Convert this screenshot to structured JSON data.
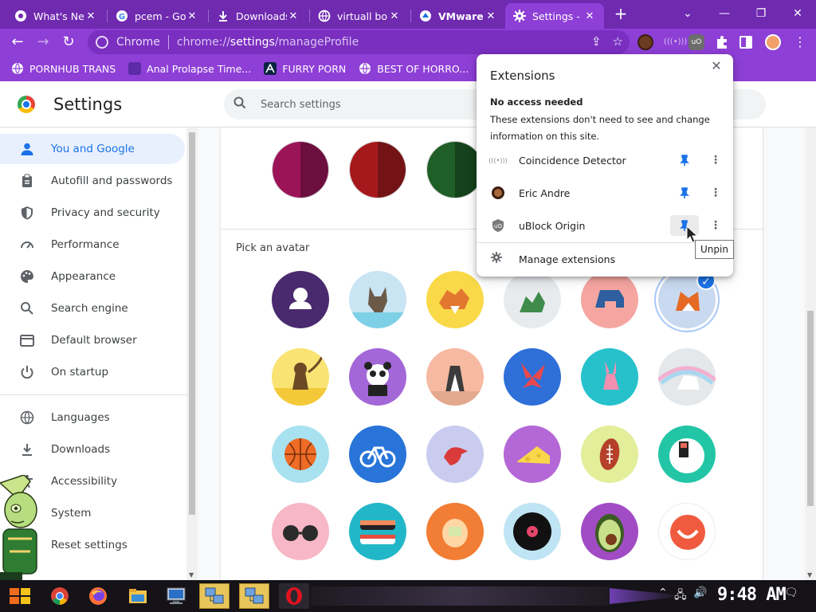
{
  "tabs": [
    {
      "title": "What's Ne",
      "icon": "chrome-pink-icon",
      "active": false
    },
    {
      "title": "pcem - Go",
      "icon": "google-icon",
      "active": false
    },
    {
      "title": "Downloads",
      "icon": "download-icon",
      "active": false
    },
    {
      "title": "virtuall bo",
      "icon": "globe-icon",
      "active": false
    },
    {
      "title": "VMware Pl",
      "icon": "vmware-icon",
      "active": false
    },
    {
      "title": "Settings -",
      "icon": "gear-icon",
      "active": true
    }
  ],
  "window_controls": {
    "minimize": "—",
    "restore": "❐",
    "close": "✕",
    "tab_search": "⌄"
  },
  "toolbar": {
    "site_label": "Chrome",
    "url_scheme": "chrome://",
    "url_host": "settings",
    "url_path": "/manageProfile"
  },
  "bookmarks": [
    {
      "label": "PORNHUB TRANS",
      "icon": "globe-icon"
    },
    {
      "label": "Anal Prolapse Time...",
      "icon": "purple-square-icon"
    },
    {
      "label": "FURRY PORN",
      "icon": "a-logo-icon"
    },
    {
      "label": "BEST OF HORRO...",
      "icon": "globe-icon"
    }
  ],
  "settings": {
    "title": "Settings",
    "search_placeholder": "Search settings",
    "nav": [
      {
        "label": "You and Google",
        "icon": "person-icon",
        "active": true
      },
      {
        "label": "Autofill and passwords",
        "icon": "clipboard-icon",
        "active": false
      },
      {
        "label": "Privacy and security",
        "icon": "shield-icon",
        "active": false
      },
      {
        "label": "Performance",
        "icon": "speedometer-icon",
        "active": false
      },
      {
        "label": "Appearance",
        "icon": "palette-icon",
        "active": false
      },
      {
        "label": "Search engine",
        "icon": "search-icon",
        "active": false
      },
      {
        "label": "Default browser",
        "icon": "browser-icon",
        "active": false
      },
      {
        "label": "On startup",
        "icon": "power-icon",
        "active": false
      },
      {
        "label": "Languages",
        "icon": "globe-icon",
        "active": false
      },
      {
        "label": "Downloads",
        "icon": "download-icon",
        "active": false
      },
      {
        "label": "Accessibility",
        "icon": "accessibility-icon",
        "active": false
      },
      {
        "label": "System",
        "icon": "wrench-icon",
        "active": false
      },
      {
        "label": "Reset settings",
        "icon": "reset-icon",
        "active": false
      }
    ],
    "pick_avatar_label": "Pick an avatar",
    "color_swatches": [
      {
        "left": "#9c1458",
        "right": "#6d0f3e"
      },
      {
        "left": "#a5191c",
        "right": "#741315"
      },
      {
        "left": "#1f5e26",
        "right": "#14421a"
      }
    ],
    "avatars": [
      {
        "name": "generic-person",
        "bg": "#4a2a6e",
        "fg": "#ffffff"
      },
      {
        "name": "origami-cat",
        "bg": "#c9e4f2",
        "fg": "#6b5a48"
      },
      {
        "name": "origami-corgi",
        "bg": "#f9d948",
        "fg": "#e2772f"
      },
      {
        "name": "origami-dragon",
        "bg": "#e7ebee",
        "fg": "#3f8b4b"
      },
      {
        "name": "origami-elephant",
        "bg": "#f6a6a1",
        "fg": "#2e5f9e"
      },
      {
        "name": "origami-fox",
        "bg": "#c9d9f0",
        "fg": "#e66a25",
        "selected": true
      },
      {
        "name": "origami-monkey",
        "bg": "#f9e373",
        "fg": "#6d4a25"
      },
      {
        "name": "origami-panda",
        "bg": "#a367d8",
        "fg": "#ffffff"
      },
      {
        "name": "origami-penguin",
        "bg": "#f6b9a1",
        "fg": "#3c3c3c"
      },
      {
        "name": "origami-butterfly",
        "bg": "#2e6fd8",
        "fg": "#e9484d"
      },
      {
        "name": "origami-rabbit",
        "bg": "#27c1cc",
        "fg": "#f08fb0"
      },
      {
        "name": "origami-unicorn",
        "bg": "#e4e8eb",
        "fg": "#d8a3e3"
      },
      {
        "name": "basketball",
        "bg": "#a8e1f0",
        "fg": "#ee6c25"
      },
      {
        "name": "bike",
        "bg": "#2874d8",
        "fg": "#ffffff"
      },
      {
        "name": "red-bird",
        "bg": "#c9ccef",
        "fg": "#d93b3b"
      },
      {
        "name": "cheese",
        "bg": "#b467d6",
        "fg": "#f8d84a"
      },
      {
        "name": "football",
        "bg": "#e3ee9a",
        "fg": "#b5412a"
      },
      {
        "name": "sushi-plate",
        "bg": "#22c6a6",
        "fg": "#ffffff"
      },
      {
        "name": "sunglasses",
        "bg": "#f7b7c6",
        "fg": "#2b2b2b"
      },
      {
        "name": "sushi",
        "bg": "#22b7c8",
        "fg": "#ffffff"
      },
      {
        "name": "tamagotchi",
        "bg": "#f27d34",
        "fg": "#ffd6a4"
      },
      {
        "name": "vinyl-record",
        "bg": "#bfe4f3",
        "fg": "#111111"
      },
      {
        "name": "avocado",
        "bg": "#a14cc5",
        "fg": "#c9e08a"
      },
      {
        "name": "smiley-bubble",
        "bg": "#ffffff",
        "fg": "#f05a3f"
      }
    ]
  },
  "extensions_popup": {
    "title": "Extensions",
    "section_title": "No access needed",
    "section_desc": "These extensions don't need to see and change information on this site.",
    "items": [
      {
        "name": "Coincidence Detector",
        "icon": "coincidence-detector-icon",
        "pinned": true
      },
      {
        "name": "Eric Andre",
        "icon": "eric-andre-icon",
        "pinned": true
      },
      {
        "name": "uBlock Origin",
        "icon": "ublock-icon",
        "pinned": true
      }
    ],
    "manage_label": "Manage extensions",
    "tooltip": "Unpin"
  },
  "taskbar": {
    "clock": "9:48 AM",
    "apps": [
      "start-icon",
      "chrome-icon",
      "firefox-icon",
      "file-explorer-icon",
      "computer-icon",
      "network-icon",
      "network-icon",
      "opera-icon"
    ]
  }
}
